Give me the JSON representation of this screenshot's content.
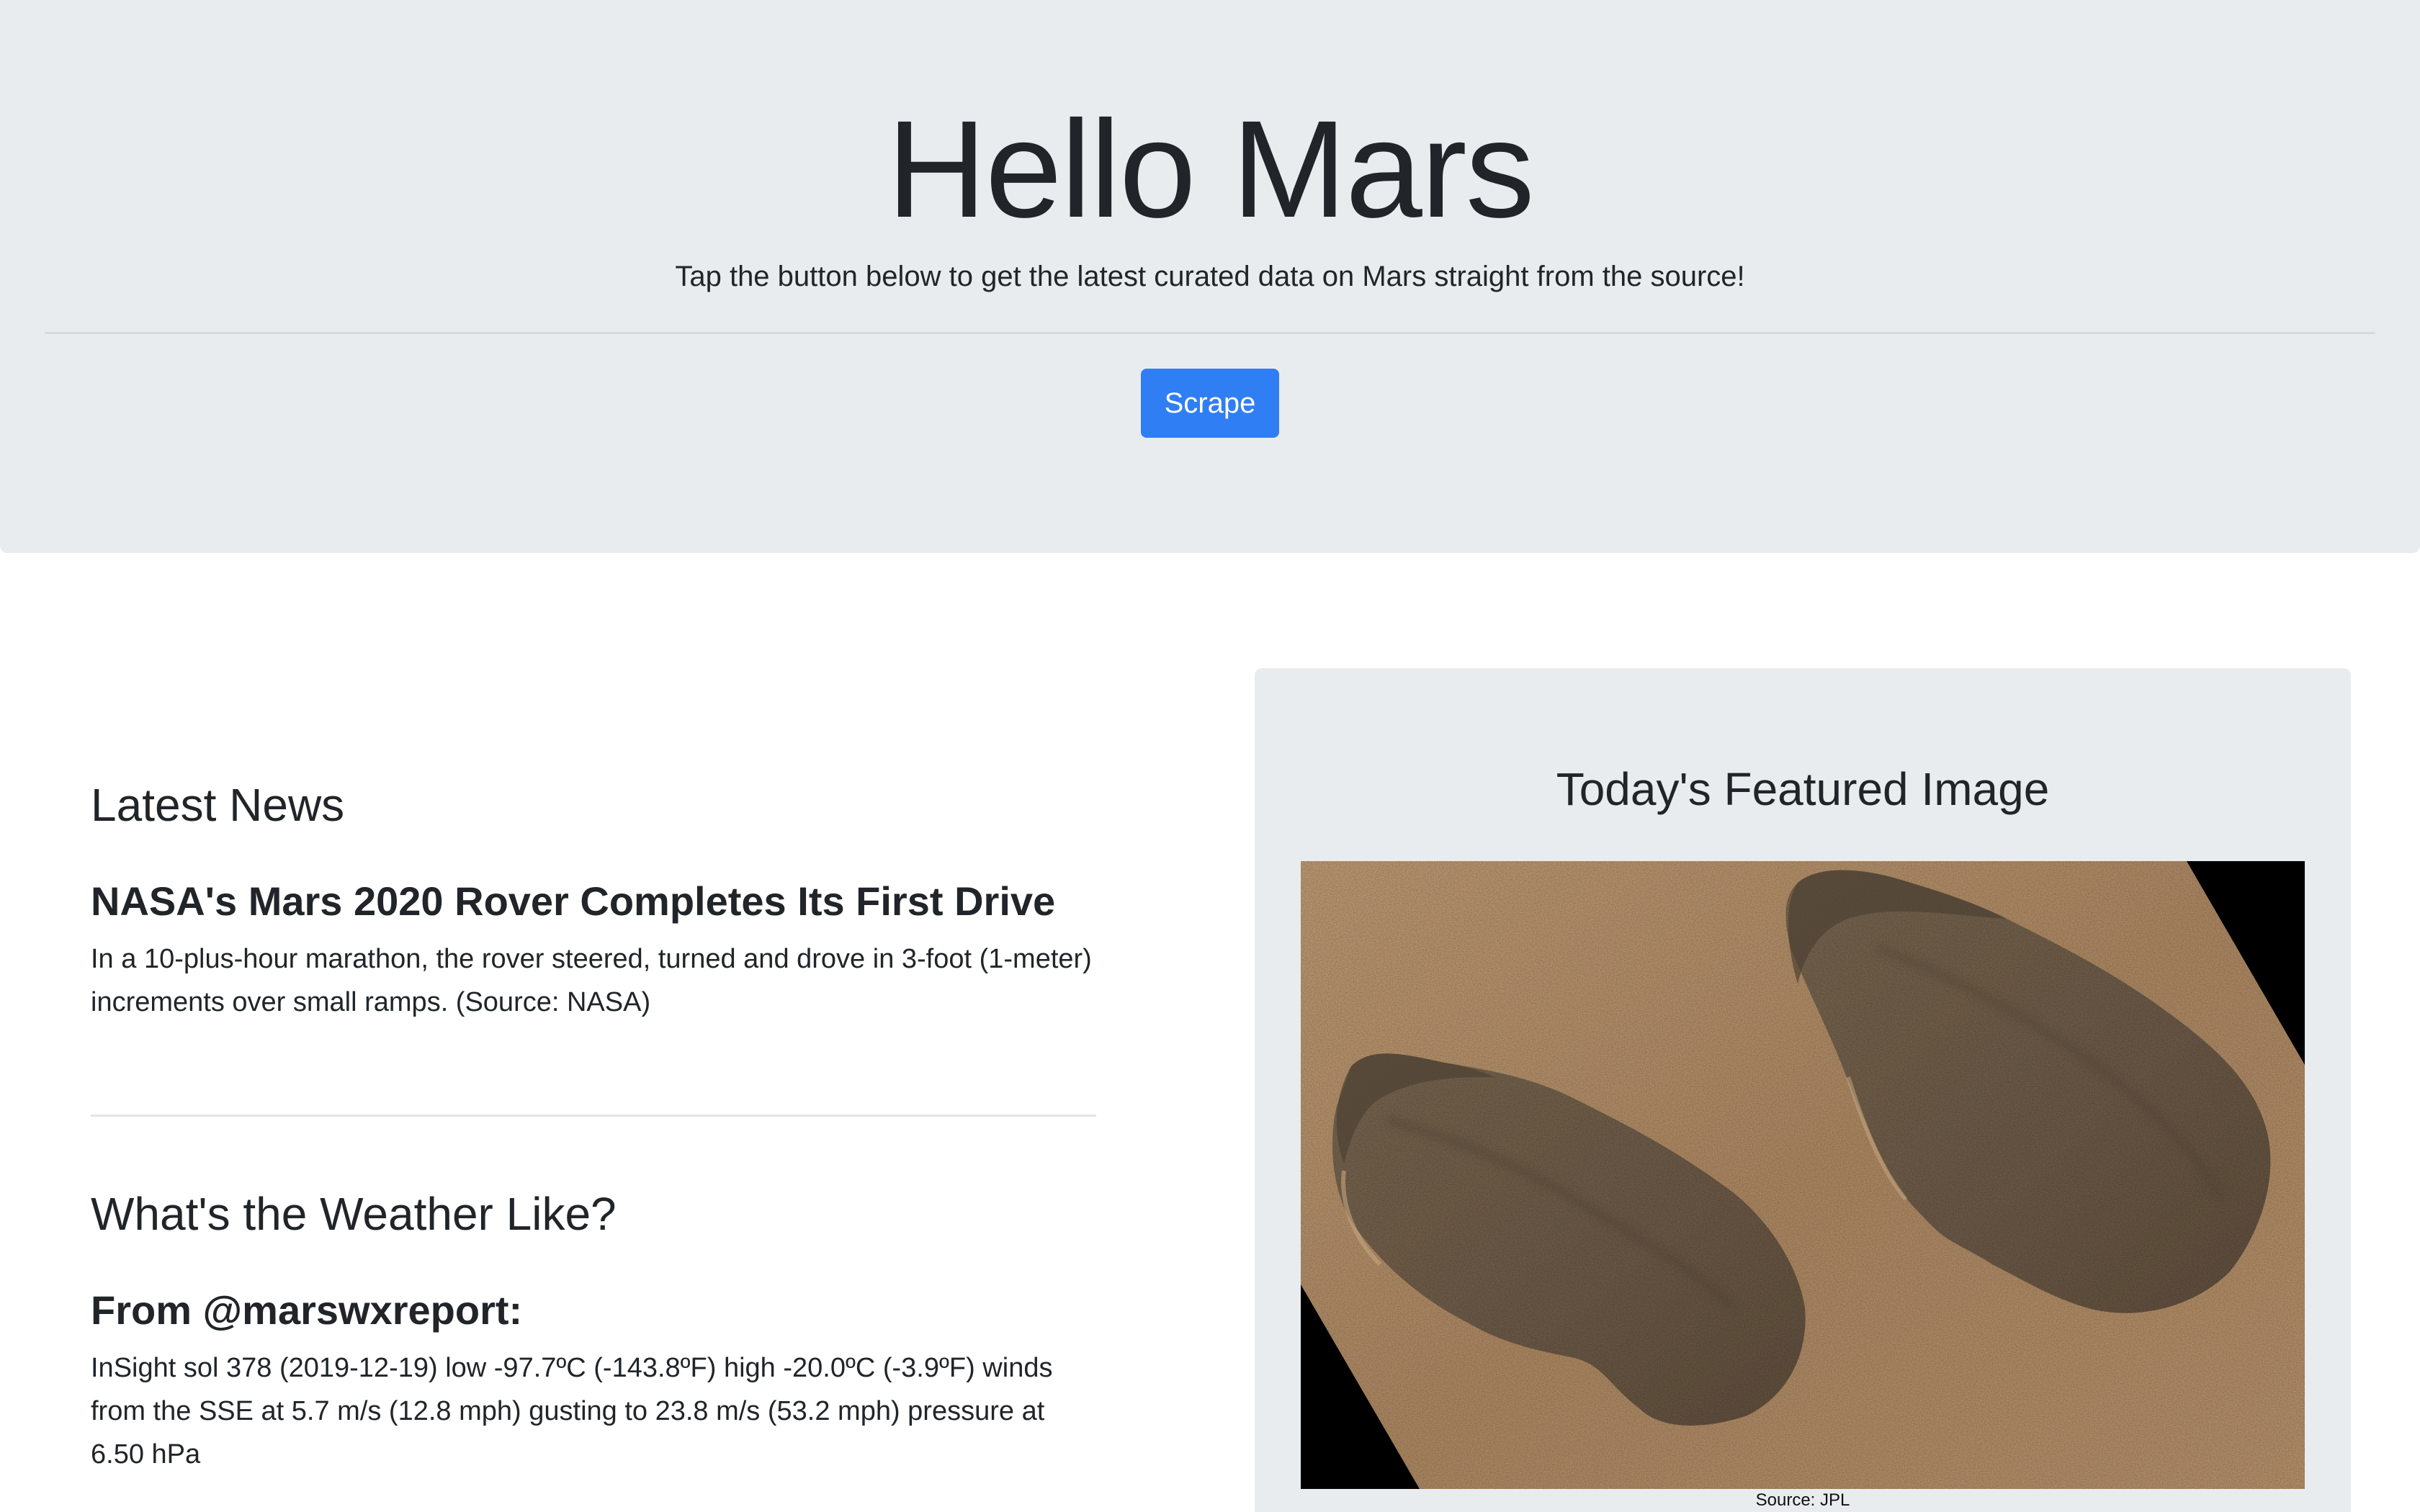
{
  "header": {
    "title": "Hello Mars",
    "lead": "Tap the button below to get the latest curated data on Mars straight from the source!",
    "button_label": "Scrape"
  },
  "news": {
    "section_title": "Latest News",
    "headline": "NASA's Mars 2020 Rover Completes Its First Drive",
    "teaser": "In a 10-plus-hour marathon, the rover steered, turned and drove in 3-foot (1-meter) increments over small ramps. (Source: NASA)"
  },
  "weather": {
    "section_title": "What's the Weather Like?",
    "source_heading": "From @marswxreport:",
    "report": "InSight sol 378 (2019-12-19) low -97.7ºC (-143.8ºF) high -20.0ºC (-3.9ºF) winds from the SSE at 5.7 m/s (12.8 mph) gusting to 23.8 m/s (53.2 mph) pressure at 6.50 hPa"
  },
  "featured": {
    "title": "Today's Featured Image",
    "caption": "Source: JPL"
  },
  "colors": {
    "jumbotron_bg": "#e9ecef",
    "button_bg": "#2f7ef4",
    "text": "#212529"
  }
}
